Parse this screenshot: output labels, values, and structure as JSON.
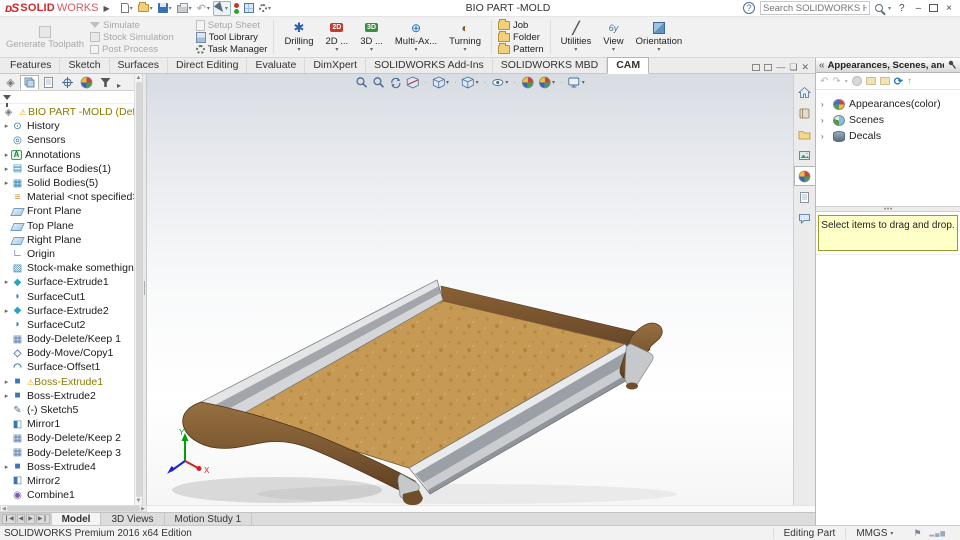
{
  "window": {
    "brand_ds": "ᴅS",
    "brand_solid": "SOLID",
    "brand_works": "WORKS",
    "title": "BIO PART -MOLD",
    "help_search_placeholder": "Search SOLIDWORKS Help",
    "help_button": "?",
    "minimize": "–",
    "close": "×"
  },
  "cam_toolbar": {
    "generate_toolpath": "Generate Toolpath",
    "simulate": "Simulate",
    "stock_simulation": "Stock Simulation",
    "post_process": "Post Process",
    "setup_sheet": "Setup Sheet",
    "tool_library": "Tool Library",
    "task_manager": "Task Manager",
    "operations": [
      {
        "label": "Drilling",
        "icon": "drilling-icon",
        "name": "drilling-button"
      },
      {
        "label": "2D ...",
        "icon": "milling-2d-icon",
        "name": "milling-2d-button"
      },
      {
        "label": "3D ...",
        "icon": "milling-3d-icon",
        "name": "milling-3d-button"
      },
      {
        "label": "Multi-Ax...",
        "icon": "multi-axis-icon",
        "name": "multi-axis-button"
      },
      {
        "label": "Turning",
        "icon": "turning-icon",
        "name": "turning-button"
      }
    ],
    "containers": [
      {
        "label": "Job",
        "icon": "folder-icon",
        "name": "job-button"
      },
      {
        "label": "Folder",
        "icon": "folder-icon",
        "name": "folder-button"
      },
      {
        "label": "Pattern",
        "icon": "folder-icon",
        "name": "pattern-button"
      }
    ],
    "tools": [
      {
        "label": "Utilities",
        "icon": "utilities-icon",
        "name": "utilities-button"
      },
      {
        "label": "View",
        "icon": "view-icon",
        "name": "view-button"
      },
      {
        "label": "Orientation",
        "icon": "orientation-icon",
        "name": "orientation-button"
      }
    ]
  },
  "ribbon_tabs": {
    "items": [
      {
        "label": "Features",
        "name": "tab-features"
      },
      {
        "label": "Sketch",
        "name": "tab-sketch"
      },
      {
        "label": "Surfaces",
        "name": "tab-surfaces"
      },
      {
        "label": "Direct Editing",
        "name": "tab-direct-editing"
      },
      {
        "label": "Evaluate",
        "name": "tab-evaluate"
      },
      {
        "label": "DimXpert",
        "name": "tab-dimxpert"
      },
      {
        "label": "SOLIDWORKS Add-Ins",
        "name": "tab-solidworks-add-ins"
      },
      {
        "label": "SOLIDWORKS MBD",
        "name": "tab-solidworks-mbd"
      },
      {
        "label": "CAM",
        "name": "tab-cam",
        "active": "active"
      }
    ]
  },
  "feature_tree": {
    "root": {
      "label": "BIO PART -MOLD  (Default<<Defa",
      "warning": "warn"
    },
    "items": [
      {
        "label": "History",
        "icon": "history-icon",
        "expand": "exp"
      },
      {
        "label": "Sensors",
        "icon": "sensors-icon"
      },
      {
        "label": "Annotations",
        "icon": "annotations-icon",
        "expand": "exp"
      },
      {
        "label": "Surface Bodies(1)",
        "icon": "surface-bodies-icon",
        "expand": "exp"
      },
      {
        "label": "Solid Bodies(5)",
        "icon": "solid-bodies-icon",
        "expand": "exp"
      },
      {
        "label": "Material <not specified>->?",
        "icon": "material-icon"
      },
      {
        "label": "Front Plane",
        "icon": "plane-icon"
      },
      {
        "label": "Top Plane",
        "icon": "plane-icon"
      },
      {
        "label": "Right Plane",
        "icon": "plane-icon"
      },
      {
        "label": "Origin",
        "icon": "origin-icon"
      },
      {
        "label": "Stock-make somethign big - wildc",
        "icon": "stock-icon"
      },
      {
        "label": "Surface-Extrude1",
        "icon": "surface-extrude-icon",
        "expand": "exp"
      },
      {
        "label": "SurfaceCut1",
        "icon": "surface-cut-icon"
      },
      {
        "label": "Surface-Extrude2",
        "icon": "surface-extrude-icon",
        "expand": "exp"
      },
      {
        "label": "SurfaceCut2",
        "icon": "surface-cut-icon"
      },
      {
        "label": "Body-Delete/Keep 1",
        "icon": "body-delete-icon"
      },
      {
        "label": "Body-Move/Copy1",
        "icon": "body-move-icon"
      },
      {
        "label": "Surface-Offset1",
        "icon": "surface-offset-icon"
      },
      {
        "label": "Boss-Extrude1",
        "icon": "boss-extrude-icon",
        "expand": "exp",
        "warning": "warn",
        "cls": "olive"
      },
      {
        "label": "Boss-Extrude2",
        "icon": "boss-extrude-icon",
        "expand": "exp"
      },
      {
        "label": "(-) Sketch5",
        "icon": "sketch-icon"
      },
      {
        "label": "Mirror1",
        "icon": "mirror-icon"
      },
      {
        "label": "Body-Delete/Keep 2",
        "icon": "body-delete-icon"
      },
      {
        "label": "Body-Delete/Keep 3",
        "icon": "body-delete-icon"
      },
      {
        "label": "Boss-Extrude4",
        "icon": "boss-extrude-icon",
        "expand": "exp"
      },
      {
        "label": "Mirror2",
        "icon": "mirror-icon"
      },
      {
        "label": "Combine1",
        "icon": "combine-icon"
      }
    ]
  },
  "viewport": {
    "triad_x": "X",
    "triad_y": "Y"
  },
  "task_pane": {
    "title": "Appearances, Scenes, and Decals",
    "tree": [
      {
        "label": "Appearances(color)",
        "icon": "appearances-icon"
      },
      {
        "label": "Scenes",
        "icon": "scenes-icon"
      },
      {
        "label": "Decals",
        "icon": "decals-icon"
      }
    ],
    "hint": "Select items to drag and drop."
  },
  "doc_tabs": {
    "items": [
      {
        "label": "Model",
        "name": "tab-model",
        "active": "active"
      },
      {
        "label": "3D Views",
        "name": "tab-3d-views"
      },
      {
        "label": "Motion Study 1",
        "name": "tab-motion-study-1"
      }
    ]
  },
  "status_bar": {
    "left": "SOLIDWORKS Premium 2016 x64 Edition",
    "mode": "Editing Part",
    "units": "MMGS"
  },
  "colors": {
    "brand_red": "#d1282e",
    "cork_tan": "#c69a55",
    "wood_dark": "#6f4e2a",
    "wood_light": "#8a6134",
    "metal_gray": "#c2c5c9",
    "warning_gold": "#f0a500",
    "hint_yellow": "#ffffc8"
  }
}
